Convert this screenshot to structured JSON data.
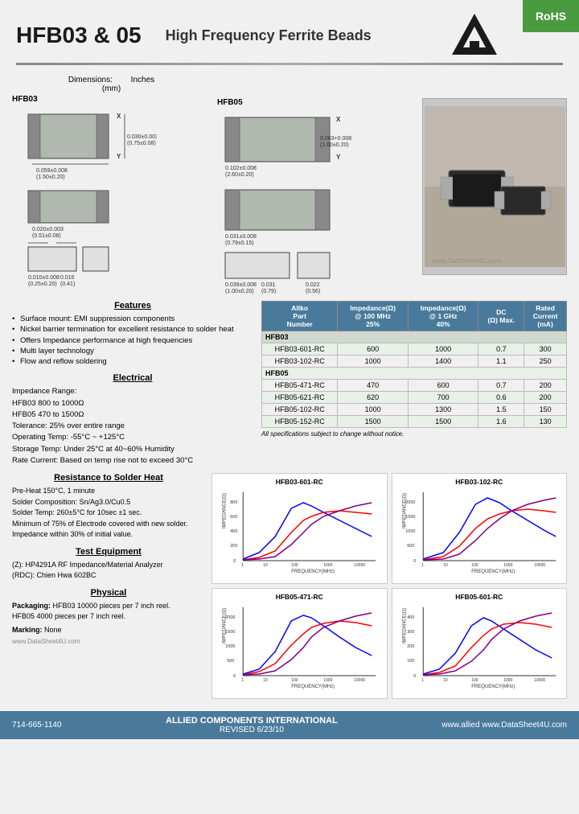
{
  "rohs": "RoHS",
  "header": {
    "title": "HFB03 & 05",
    "subtitle": "High Frequency Ferrite Beads"
  },
  "dimensions": {
    "label": "Dimensions:",
    "unit1": "Inches",
    "unit2": "(mm)",
    "hfb03_label": "HFB03",
    "hfb05_label": "HFB05"
  },
  "features": {
    "title": "Features",
    "items": [
      "Surface mount: EMI suppression components",
      "Nickel barrier termination for excellent resistance to solder heat",
      "Offers Impedance performance at high frequencies",
      "Multi layer technology",
      "Flow and reflow soldering"
    ]
  },
  "electrical": {
    "title": "Electrical",
    "content": [
      "Impedance Range:",
      "HFB03 800 to 1000Ω",
      "HFB05 470 to 1500Ω",
      "Tolerance: 25% over entire range",
      "Operating Temp: -55°C ~ +125°C",
      "Storage Temp: Under 25°C at 40~60% Humidity",
      "Rate Current: Based on temp rise not to exceed 30°C"
    ]
  },
  "solder_heat": {
    "title": "Resistance to Solder Heat",
    "lines": [
      "Pre-Heat 150°C, 1 minute",
      "Solder Composition: Sn/Ag3.0/Cu0.5",
      "Solder Temp: 260±5°C for 10sec ±1 sec.",
      "Minimum of 75% of Electrode covered with new solder.",
      "Impedance within 30% of initial value."
    ]
  },
  "test_equipment": {
    "title": "Test Equipment",
    "lines": [
      "(Z): HP4291A RF Impedance/Material Analyzer",
      "(RDC): Chien Hwa 602BC"
    ]
  },
  "physical": {
    "title": "Physical",
    "packaging_label": "Packaging:",
    "packaging_hfb03": "HFB03 10000 pieces per 7 inch reel.",
    "packaging_hfb05": "HFB05 4000 pieces per 7 inch reel.",
    "marking_label": "Marking:",
    "marking_value": "None"
  },
  "table": {
    "headers": [
      "Allko\nPart\nNumber",
      "Impedance(Ω)\n@ 100 MHz\n25%",
      "Impedance(Ω)\n@ 1 GHz\n40%",
      "DC\n(Ω) Max.",
      "Rated\nCurrent\n(mA)"
    ],
    "hfb03_group": "HFB03",
    "hfb05_group": "HFB05",
    "rows": [
      {
        "part": "HFB03-601-RC",
        "imp100": "600",
        "imp1g": "1000",
        "dc": "0.7",
        "current": "300"
      },
      {
        "part": "HFB03-102-RC",
        "imp100": "1000",
        "imp1g": "1400",
        "dc": "1.1",
        "current": "250"
      },
      {
        "part": "HFB05-471-RC",
        "imp100": "470",
        "imp1g": "600",
        "dc": "0.7",
        "current": "200"
      },
      {
        "part": "HFB05-621-RC",
        "imp100": "620",
        "imp1g": "700",
        "dc": "0.6",
        "current": "200"
      },
      {
        "part": "HFB05-102-RC",
        "imp100": "1000",
        "imp1g": "1300",
        "dc": "1.5",
        "current": "150"
      },
      {
        "part": "HFB05-152-RC",
        "imp100": "1500",
        "imp1g": "1500",
        "dc": "1.6",
        "current": "130"
      }
    ],
    "note": "All specifications subject to change without notice."
  },
  "graphs": [
    {
      "title": "HFB03-601-RC",
      "y_label": "IMPEDANCE(Ω)",
      "x_label": "FREQUENCY(MHz)"
    },
    {
      "title": "HFB03-102-RC",
      "y_label": "IMPEDANCE(Ω)",
      "x_label": "FREQUENCY(MHz)"
    },
    {
      "title": "HFB05-471-RC",
      "y_label": "IMPEDANCE(Ω)",
      "x_label": "FREQUENCY(MHz)"
    },
    {
      "title": "HFB05-601-RC",
      "y_label": "IMPEDANCE(Ω)",
      "x_label": "FREQUENCY(MHz)"
    }
  ],
  "footer": {
    "phone": "714-665-1140",
    "company": "ALLIED COMPONENTS INTERNATIONAL",
    "revised": "REVISED 6/23/10",
    "website1": "www.allied",
    "website2": "www.DataSheet4U.com"
  }
}
